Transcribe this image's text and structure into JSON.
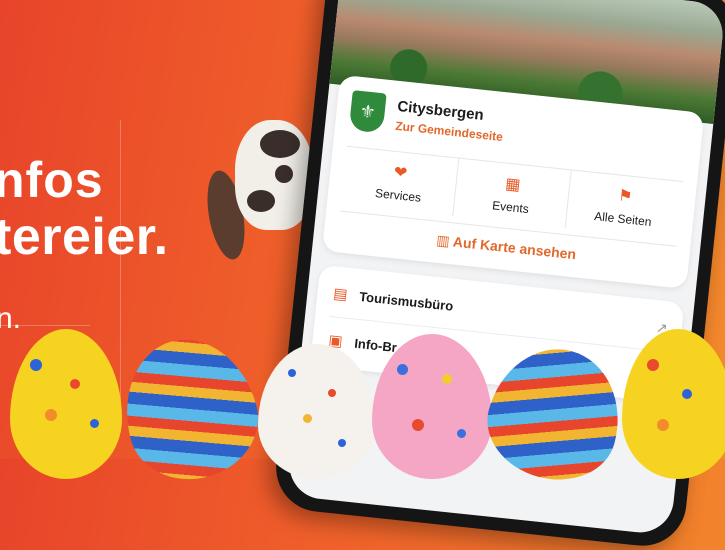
{
  "headline": {
    "line1": "nfos",
    "line2": "tereier.",
    "subline": "n."
  },
  "app": {
    "municipality": {
      "name": "Citysbergen",
      "link": "Zur Gemeindeseite"
    },
    "quick_actions": [
      {
        "label": "Services",
        "icon": "hand-heart-icon"
      },
      {
        "label": "Events",
        "icon": "calendar-icon"
      },
      {
        "label": "Alle Seiten",
        "icon": "flag-icon"
      }
    ],
    "map_button": "Auf Karte ansehen",
    "list": [
      {
        "label": "Tourismusbüro",
        "icon": "building-icon",
        "external": true
      },
      {
        "label": "Info-Br",
        "icon": "info-icon",
        "external": false
      }
    ]
  },
  "colors": {
    "accent": "#e2682b",
    "background_start": "#e8442a",
    "background_end": "#f38a2c"
  }
}
